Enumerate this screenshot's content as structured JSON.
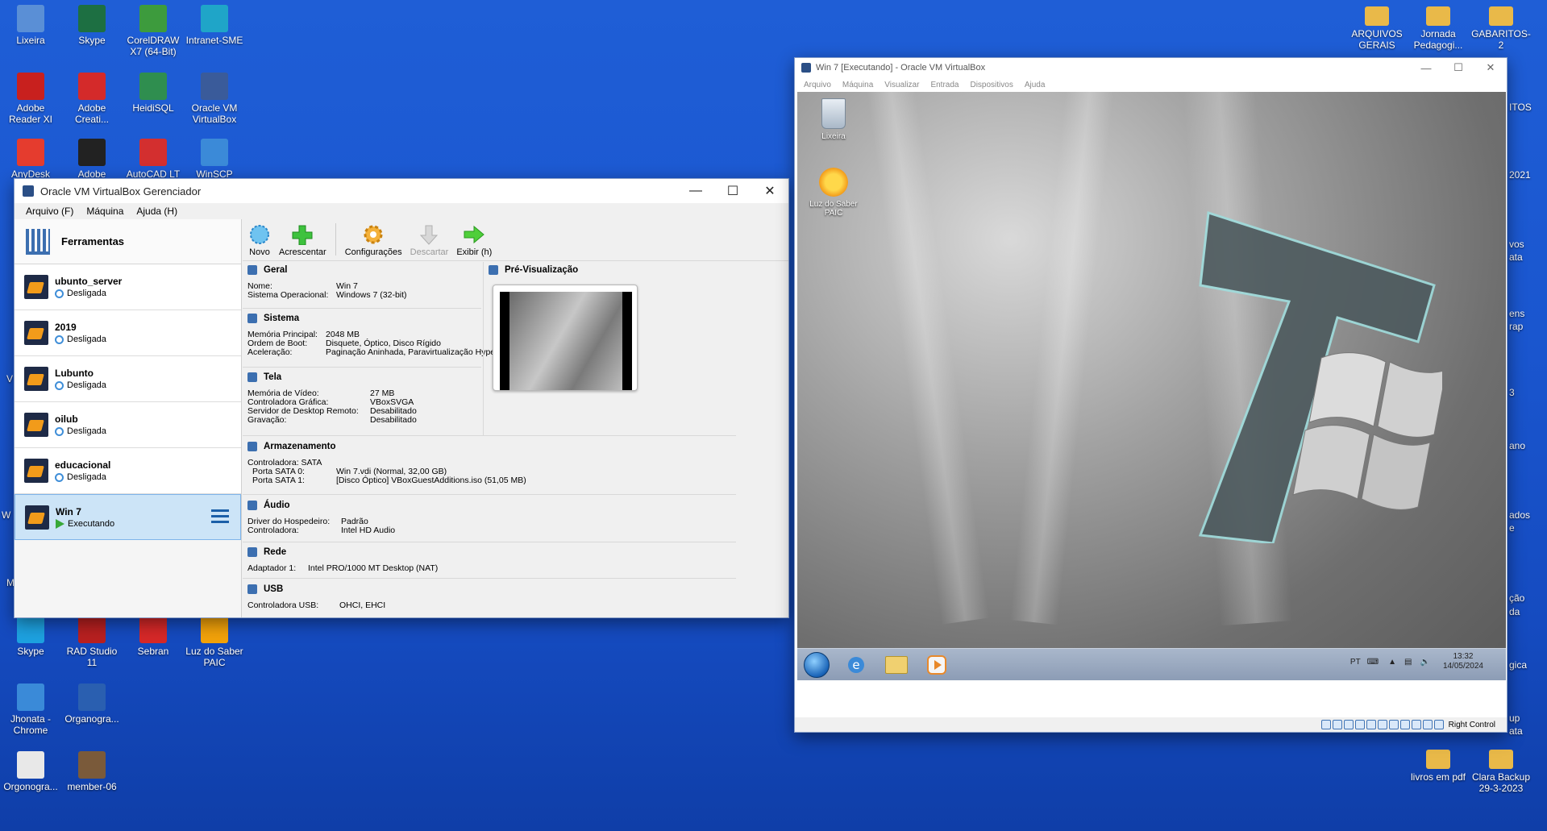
{
  "desktop": {
    "left_icons": [
      {
        "label": "Lixeira",
        "icon": "recycle-bin-icon",
        "color": "#5a8fd6"
      },
      {
        "label": "Skype",
        "icon": "excel-icon",
        "color": "#1d6f42"
      },
      {
        "label": "CorelDRAW X7 (64-Bit)",
        "icon": "coreldraw-icon",
        "color": "#3d9b3d"
      },
      {
        "label": "Intranet-SME",
        "icon": "edge-icon",
        "color": "#1fa5c8"
      },
      {
        "label": "Adobe Reader XI",
        "icon": "adobe-reader-icon",
        "color": "#c8201e"
      },
      {
        "label": "Adobe Creati...",
        "icon": "adobe-cc-icon",
        "color": "#d42a2a"
      },
      {
        "label": "HeidiSQL",
        "icon": "heidisql-icon",
        "color": "#2f8e4f"
      },
      {
        "label": "Oracle VM VirtualBox",
        "icon": "virtualbox-icon",
        "color": "#3a5b9a"
      },
      {
        "label": "AnyDesk",
        "icon": "anydesk-icon",
        "color": "#e53c2e"
      },
      {
        "label": "Adobe",
        "icon": "adobe-acrobat-icon",
        "color": "#222222"
      },
      {
        "label": "AutoCAD LT",
        "icon": "autocad-icon",
        "color": "#d32f2f"
      },
      {
        "label": "WinSCP",
        "icon": "winscp-icon",
        "color": "#3b8ad8"
      },
      {
        "label": "Skype",
        "icon": "skype-icon",
        "color": "#1da1e0"
      },
      {
        "label": "RAD Studio 11",
        "icon": "rad-studio-icon",
        "color": "#b82020"
      },
      {
        "label": "Sebran",
        "icon": "sebran-icon",
        "color": "#d62828"
      },
      {
        "label": "Luz do Saber PAIC",
        "icon": "sun-icon",
        "color": "#f2a20a"
      },
      {
        "label": "Jhonata - Chrome",
        "icon": "chrome-icon",
        "color": "#3a8ad8"
      },
      {
        "label": "Organogra...",
        "icon": "word-icon",
        "color": "#2a5fb0"
      },
      {
        "label": "Orgonogra...",
        "icon": "pdf-icon",
        "color": "#e8e8e8"
      },
      {
        "label": "member-06",
        "icon": "photo-icon",
        "color": "#7a5a3a"
      }
    ],
    "left_partial": [
      "V",
      "M",
      "W"
    ],
    "right_icons": [
      {
        "label": "ARQUIVOS GERAIS",
        "icon": "folder-icon"
      },
      {
        "label": "Jornada Pedagogi...",
        "icon": "folder-icon"
      },
      {
        "label": "GABARITOS-2",
        "icon": "folder-icon"
      },
      {
        "label": "livros em pdf",
        "icon": "folder-icon"
      },
      {
        "label": "Clara Backup 29-3-2023",
        "icon": "folder-icon"
      }
    ],
    "right_partial": [
      "ITOS",
      "2021",
      "vos",
      "ata",
      "ens",
      "rap",
      "3",
      "ano",
      "ados",
      "e",
      "ção",
      "da",
      "gica",
      "up",
      "ata"
    ]
  },
  "manager": {
    "title": "Oracle VM VirtualBox Gerenciador",
    "menu": [
      "Arquivo (F)",
      "Máquina",
      "Ajuda (H)"
    ],
    "tools_label": "Ferramentas",
    "vms": [
      {
        "name": "ubunto_server",
        "state": "Desligada",
        "running": false
      },
      {
        "name": "2019",
        "state": "Desligada",
        "running": false
      },
      {
        "name": "Lubunto",
        "state": "Desligada",
        "running": false
      },
      {
        "name": "oilub",
        "state": "Desligada",
        "running": false
      },
      {
        "name": "educacional",
        "state": "Desligada",
        "running": false
      },
      {
        "name": "Win 7",
        "state": "Executando",
        "running": true
      }
    ],
    "toolbar": {
      "novo": "Novo",
      "acrescentar": "Acrescentar",
      "configuracoes": "Configurações",
      "descartar": "Descartar",
      "exibir": "Exibir (h)"
    },
    "details": {
      "geral": {
        "title": "Geral",
        "rows": [
          [
            "Nome:",
            "Win 7"
          ],
          [
            "Sistema Operacional:",
            "Windows 7 (32-bit)"
          ]
        ]
      },
      "sistema": {
        "title": "Sistema",
        "rows": [
          [
            "Memória Principal:",
            "2048 MB"
          ],
          [
            "Ordem de Boot:",
            "Disquete, Óptico, Disco Rígido"
          ],
          [
            "Aceleração:",
            "Paginação Aninhada, Paravirtualização Hyper-V"
          ]
        ]
      },
      "tela": {
        "title": "Tela",
        "rows": [
          [
            "Memória de Vídeo:",
            "27 MB"
          ],
          [
            "Controladora Gráfica:",
            "VBoxSVGA"
          ],
          [
            "Servidor de Desktop Remoto:",
            "Desabilitado"
          ],
          [
            "Gravação:",
            "Desabilitado"
          ]
        ]
      },
      "armazenamento": {
        "title": "Armazenamento",
        "rows": [
          [
            "Controladora: SATA",
            ""
          ],
          [
            " Porta SATA 0:",
            "Win 7.vdi (Normal, 32,00 GB)"
          ],
          [
            " Porta SATA 1:",
            "[Disco Óptico] VBoxGuestAdditions.iso (51,05 MB)"
          ]
        ]
      },
      "audio": {
        "title": "Áudio",
        "rows": [
          [
            "Driver do Hospedeiro:",
            "Padrão"
          ],
          [
            "Controladora:",
            "Intel HD Audio"
          ]
        ]
      },
      "rede": {
        "title": "Rede",
        "rows": [
          [
            "Adaptador 1:",
            "Intel PRO/1000 MT Desktop (NAT)"
          ]
        ]
      },
      "usb": {
        "title": "USB",
        "rows": [
          [
            "Controladora USB:",
            "OHCI, EHCI"
          ]
        ]
      },
      "preview": {
        "title": "Pré-Visualização"
      }
    }
  },
  "guest": {
    "title": "Win 7 [Executando] - Oracle VM VirtualBox",
    "menu": [
      "Arquivo",
      "Máquina",
      "Visualizar",
      "Entrada",
      "Dispositivos",
      "Ajuda"
    ],
    "desktop_icons": [
      {
        "label": "Lixeira",
        "icon": "recycle-bin-icon"
      },
      {
        "label": "Luz do Saber PAIC",
        "icon": "sun-icon"
      }
    ],
    "tray": {
      "lang": "PT",
      "time": "13:32",
      "date": "14/05/2024"
    },
    "status": {
      "host_key": "Right Control"
    }
  }
}
